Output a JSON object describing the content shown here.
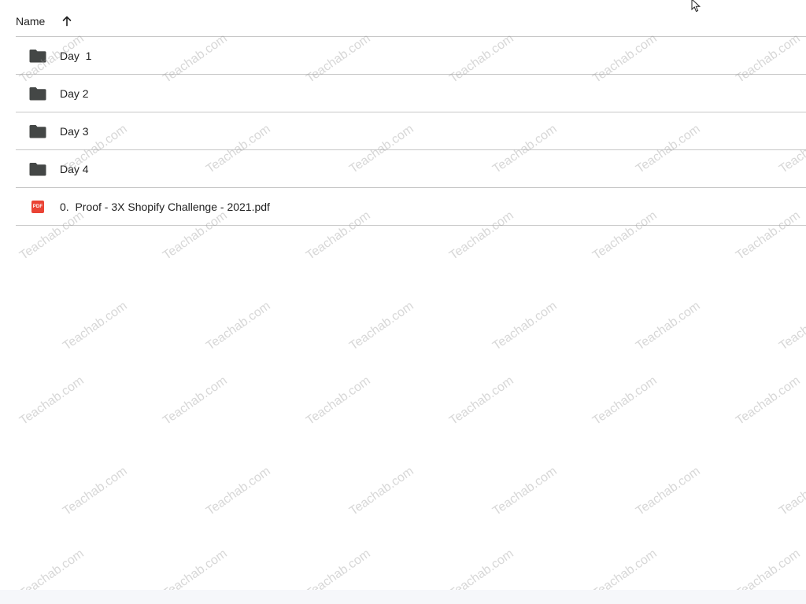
{
  "header": {
    "name_label": "Name",
    "sort_icon": "arrow-up-icon"
  },
  "rows": [
    {
      "label": "Day  1",
      "icon": "folder-icon"
    },
    {
      "label": "Day 2",
      "icon": "folder-icon"
    },
    {
      "label": "Day 3",
      "icon": "folder-icon"
    },
    {
      "label": "Day 4",
      "icon": "folder-icon"
    },
    {
      "label": "0.  Proof - 3X Shopify Challenge - 2021.pdf",
      "icon": "pdf-icon",
      "badge": "PDF"
    }
  ],
  "watermark": {
    "text": "Teachab.com"
  },
  "colors": {
    "folder": "#444746",
    "pdf": "#ea4335",
    "divider": "#c7c7c7"
  }
}
